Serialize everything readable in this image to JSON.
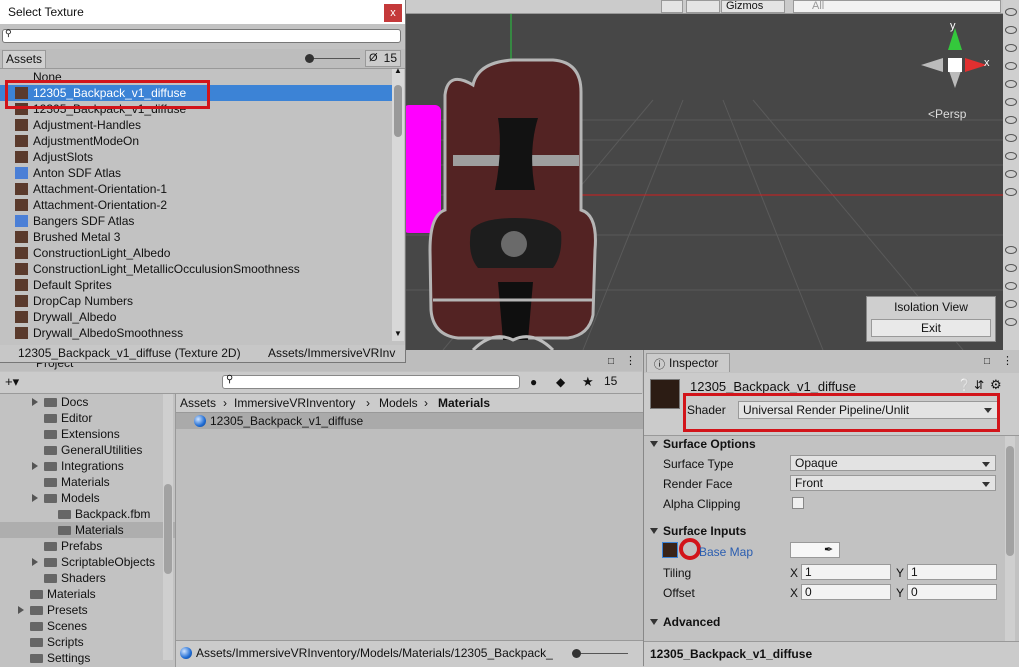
{
  "colors": {
    "selection": "#3c83d6",
    "highlight_box": "#d2141a",
    "link": "#2a5db0",
    "magenta": "#ff00ff"
  },
  "scene": {
    "toolbar": {
      "gizmos_label": "Gizmos",
      "search_placeholder": "All"
    },
    "gizmo": {
      "x_label": "x",
      "y_label": "y",
      "persp_label": "Persp"
    },
    "isolation": {
      "title": "Isolation View",
      "exit_label": "Exit"
    }
  },
  "picker": {
    "title": "Select Texture",
    "close_glyph": "x",
    "search_value": "",
    "assets_tab": "Assets",
    "hidden_count": "15",
    "items": [
      {
        "label": "None",
        "icon": "none",
        "selected": false
      },
      {
        "label": "12305_Backpack_v1_diffuse",
        "icon": "texture-thumbnail",
        "selected": true
      },
      {
        "label": "12305_Backpack_v1_diffuse",
        "icon": "texture-thumbnail",
        "selected": false
      },
      {
        "label": "Adjustment-Handles",
        "icon": "texture-thumbnail",
        "selected": false
      },
      {
        "label": "AdjustmentModeOn",
        "icon": "texture-thumbnail",
        "selected": false
      },
      {
        "label": "AdjustSlots",
        "icon": "texture-thumbnail",
        "selected": false
      },
      {
        "label": "Anton SDF Atlas",
        "icon": "atlas-thumbnail",
        "selected": false
      },
      {
        "label": "Attachment-Orientation-1",
        "icon": "texture-thumbnail",
        "selected": false
      },
      {
        "label": "Attachment-Orientation-2",
        "icon": "texture-thumbnail",
        "selected": false
      },
      {
        "label": "Bangers SDF Atlas",
        "icon": "atlas-thumbnail",
        "selected": false
      },
      {
        "label": "Brushed Metal 3",
        "icon": "texture-thumbnail",
        "selected": false
      },
      {
        "label": "ConstructionLight_Albedo",
        "icon": "texture-thumbnail",
        "selected": false
      },
      {
        "label": "ConstructionLight_MetallicOcculusionSmoothness",
        "icon": "texture-thumbnail",
        "selected": false
      },
      {
        "label": "Default Sprites",
        "icon": "texture-thumbnail",
        "selected": false
      },
      {
        "label": "DropCap Numbers",
        "icon": "texture-thumbnail",
        "selected": false
      },
      {
        "label": "Drywall_Albedo",
        "icon": "texture-thumbnail",
        "selected": false
      },
      {
        "label": "Drywall_AlbedoSmoothness",
        "icon": "texture-thumbnail",
        "selected": false
      }
    ],
    "status_name": "12305_Backpack_v1_diffuse (Texture 2D)",
    "status_path": "Assets/ImmersiveVRInv"
  },
  "project": {
    "tab_label": "Project",
    "hidden_count": "15",
    "tree": [
      {
        "label": "Docs",
        "depth": 1,
        "arrow": true,
        "selected": false
      },
      {
        "label": "Editor",
        "depth": 1,
        "arrow": false,
        "selected": false
      },
      {
        "label": "Extensions",
        "depth": 1,
        "arrow": false,
        "selected": false
      },
      {
        "label": "GeneralUtilities",
        "depth": 1,
        "arrow": false,
        "selected": false
      },
      {
        "label": "Integrations",
        "depth": 1,
        "arrow": true,
        "selected": false
      },
      {
        "label": "Materials",
        "depth": 1,
        "arrow": false,
        "selected": false
      },
      {
        "label": "Models",
        "depth": 1,
        "arrow": true,
        "selected": false
      },
      {
        "label": "Backpack.fbm",
        "depth": 2,
        "arrow": false,
        "selected": false
      },
      {
        "label": "Materials",
        "depth": 2,
        "arrow": false,
        "selected": true
      },
      {
        "label": "Prefabs",
        "depth": 1,
        "arrow": false,
        "selected": false
      },
      {
        "label": "ScriptableObjects",
        "depth": 1,
        "arrow": true,
        "selected": false
      },
      {
        "label": "Shaders",
        "depth": 1,
        "arrow": false,
        "selected": false
      },
      {
        "label": "Materials",
        "depth": 0,
        "arrow": false,
        "selected": false
      },
      {
        "label": "Presets",
        "depth": 0,
        "arrow": true,
        "selected": false
      },
      {
        "label": "Scenes",
        "depth": 0,
        "arrow": false,
        "selected": false
      },
      {
        "label": "Scripts",
        "depth": 0,
        "arrow": false,
        "selected": false
      },
      {
        "label": "Settings",
        "depth": 0,
        "arrow": false,
        "selected": false
      }
    ],
    "breadcrumb": [
      "Assets",
      "ImmersiveVRInventory",
      "Models",
      "Materials"
    ],
    "asset_item": "12305_Backpack_v1_diffuse",
    "path": "Assets/ImmersiveVRInventory/Models/Materials/12305_Backpack_"
  },
  "inspector": {
    "tab_label": "Inspector",
    "material_name": "12305_Backpack_v1_diffuse",
    "shader_label": "Shader",
    "shader_value": "Universal Render Pipeline/Unlit",
    "surface_options": {
      "title": "Surface Options",
      "surface_type_label": "Surface Type",
      "surface_type_value": "Opaque",
      "render_face_label": "Render Face",
      "render_face_value": "Front",
      "alpha_clipping_label": "Alpha Clipping"
    },
    "surface_inputs": {
      "title": "Surface Inputs",
      "base_map_label": "Base Map",
      "tiling_label": "Tiling",
      "tiling_x": "1",
      "tiling_y": "1",
      "offset_label": "Offset",
      "offset_x": "0",
      "offset_y": "0",
      "x_label": "X",
      "y_label": "Y"
    },
    "advanced_title": "Advanced",
    "footer_name": "12305_Backpack_v1_diffuse"
  }
}
